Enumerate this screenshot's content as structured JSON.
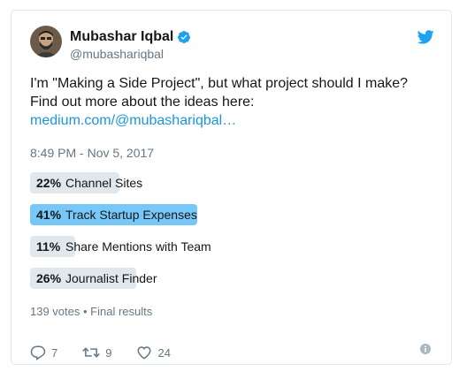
{
  "user": {
    "name": "Mubashar Iqbal",
    "handle": "@mubashariqbal"
  },
  "tweet": {
    "text": "I'm \"Making a Side Project\", but what project should I make? Find out more about the ideas here:",
    "link": "medium.com/@mubashariqbal…",
    "timestamp": "8:49 PM - Nov 5, 2017"
  },
  "poll": {
    "options": [
      {
        "percent": "22%",
        "label": "Channel Sites",
        "fraction": 0.22
      },
      {
        "percent": "41%",
        "label": "Track Startup Expenses",
        "fraction": 0.41
      },
      {
        "percent": "11%",
        "label": "Share Mentions with Team",
        "fraction": 0.11
      },
      {
        "percent": "26%",
        "label": "Journalist Finder",
        "fraction": 0.26
      }
    ],
    "summary": "139 votes • Final results"
  },
  "actions": {
    "reply_count": "7",
    "retweet_count": "9",
    "like_count": "24"
  },
  "colors": {
    "accent": "#1da1f2",
    "link": "#1b95e0",
    "winning_bar": "#77c7f7",
    "bar": "#e1e8ed"
  },
  "icons": [
    "verified-icon",
    "twitter-bird-icon",
    "reply-icon",
    "retweet-icon",
    "like-icon",
    "info-icon"
  ]
}
